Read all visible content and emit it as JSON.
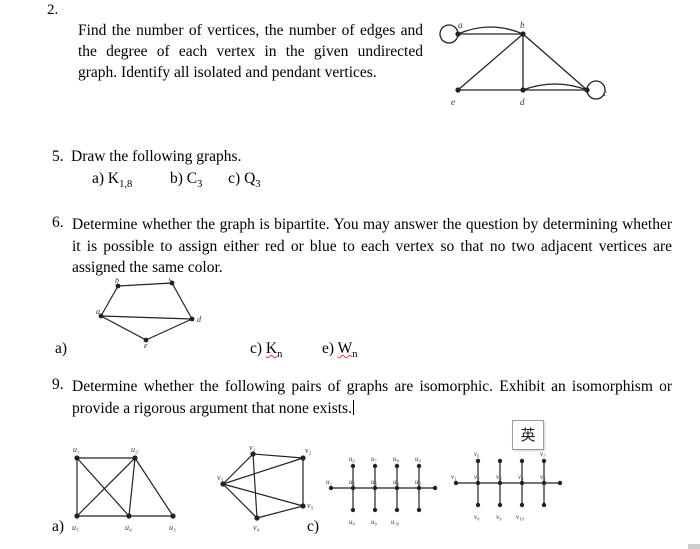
{
  "document": {
    "problems": [
      {
        "number": "2.",
        "text": "Find the number of vertices, the number of edges and the degree of each vertex in the given undirected graph. Identify all isolated and pendant vertices.",
        "figure_vertex_labels": [
          "a",
          "b",
          "c",
          "d",
          "e"
        ]
      },
      {
        "number": "5.",
        "text": "Draw the following graphs.",
        "items": [
          {
            "label": "a)",
            "name": "K",
            "subscript": "1,8"
          },
          {
            "label": "b)",
            "name": "C",
            "subscript": "3"
          },
          {
            "label": "c)",
            "name": "Q",
            "subscript": "3"
          }
        ]
      },
      {
        "number": "6.",
        "text": "Determine whether the graph is bipartite. You may answer the question by determining whether it is possible to assign either red or blue to each vertex so that no two adjacent vertices are assigned the same color.",
        "figure_vertex_labels": [
          "a",
          "b",
          "c",
          "d",
          "e"
        ],
        "subparts": [
          {
            "label": "a)"
          },
          {
            "label": "c)",
            "name": "K",
            "subscript": "n"
          },
          {
            "label": "e)",
            "name": "W",
            "subscript": "n"
          }
        ]
      },
      {
        "number": "9.",
        "text": "Determine whether the following pairs of graphs are isomorphic. Exhibit an isomorphism or provide a rigorous argument that none exists.",
        "subparts": [
          {
            "label": "a)"
          },
          {
            "label": "c)"
          }
        ],
        "figures": {
          "a_left_labels": [
            "u1",
            "u2",
            "u3",
            "u4",
            "u5"
          ],
          "a_right_labels": [
            "v1",
            "v2",
            "v3",
            "v4",
            "v5"
          ],
          "c_left_labels": [
            "u1",
            "u2",
            "u3",
            "u4",
            "u5",
            "u6",
            "u7",
            "u8",
            "u9",
            "u10"
          ],
          "c_right_labels": [
            "v1",
            "v2",
            "v3",
            "v4",
            "v5",
            "v6",
            "v7",
            "v8",
            "v9",
            "v10"
          ]
        }
      }
    ],
    "ime_indicator": "英"
  }
}
